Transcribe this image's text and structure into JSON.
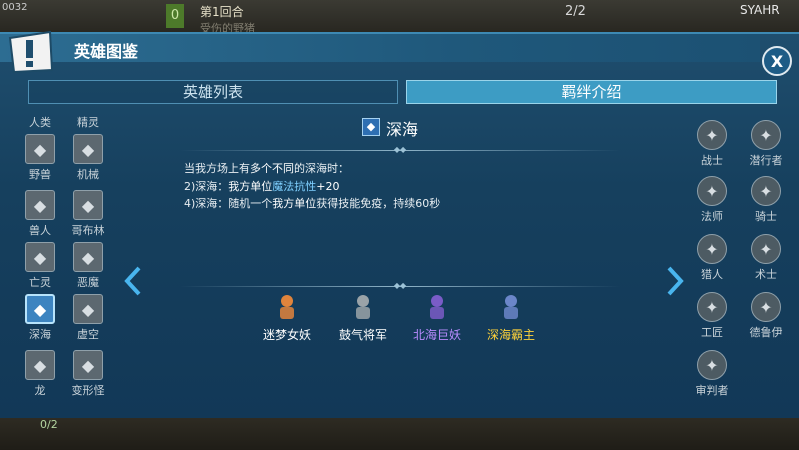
{
  "hud": {
    "clock": "0032",
    "level": "0",
    "round": "第1回合",
    "subtitle": "受伤的野猪",
    "score": "2/2",
    "player": "SYAHR",
    "bottom_count": "0/2"
  },
  "panel": {
    "title": "英雄图鉴",
    "close_label": "X",
    "tabs": [
      {
        "label": "英雄列表",
        "active": false
      },
      {
        "label": "羁绊介绍",
        "active": true
      }
    ]
  },
  "left_categories": [
    {
      "label": "人类",
      "icon": "human-icon"
    },
    {
      "label": "精灵",
      "icon": "elf-icon"
    },
    {
      "label": "野兽",
      "icon": "beast-icon"
    },
    {
      "label": "机械",
      "icon": "mech-icon"
    },
    {
      "label": "兽人",
      "icon": "orc-icon"
    },
    {
      "label": "哥布林",
      "icon": "goblin-icon"
    },
    {
      "label": "亡灵",
      "icon": "undead-icon"
    },
    {
      "label": "恶魔",
      "icon": "demon-icon"
    },
    {
      "label": "深海",
      "icon": "deepsea-icon",
      "selected": true
    },
    {
      "label": "虚空",
      "icon": "void-icon"
    },
    {
      "label": "龙",
      "icon": "dragon-icon"
    },
    {
      "label": "变形怪",
      "icon": "shapeshifter-icon"
    }
  ],
  "right_classes": [
    {
      "label": "战士",
      "icon": "warrior-icon"
    },
    {
      "label": "潜行者",
      "icon": "rogue-icon"
    },
    {
      "label": "法师",
      "icon": "mage-icon"
    },
    {
      "label": "骑士",
      "icon": "knight-icon"
    },
    {
      "label": "猎人",
      "icon": "hunter-icon"
    },
    {
      "label": "术士",
      "icon": "warlock-icon"
    },
    {
      "label": "工匠",
      "icon": "craftsman-icon"
    },
    {
      "label": "德鲁伊",
      "icon": "druid-icon"
    },
    {
      "label": "审判者",
      "icon": "inquisitor-icon"
    }
  ],
  "bond": {
    "name": "深海",
    "line1_a": "当我方场上有",
    "line1_b": "多个不同",
    "line1_c": "的深海时：",
    "line2_a": "2)深海：",
    "line2_b": "我方单位",
    "line2_c": "魔法抗性",
    "line2_d": "+20",
    "line3_a": "4)深海：",
    "line3_b": "随机一个",
    "line3_c": "我方单位",
    "line3_d": "获得技能免疫，持续60秒"
  },
  "heroes": [
    {
      "name": "迷梦女妖",
      "color": "#ffffff"
    },
    {
      "name": "鼓气将军",
      "color": "#ffffff"
    },
    {
      "name": "北海巨妖",
      "color": "#b98cff"
    },
    {
      "name": "深海霸主",
      "color": "#ffd23a"
    }
  ]
}
